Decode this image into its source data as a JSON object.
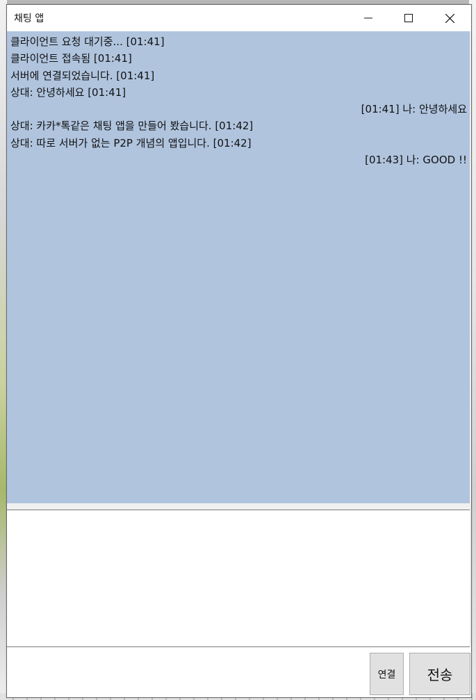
{
  "window": {
    "title": "채팅 앱",
    "controls": {
      "minimize_icon": "minimize-icon",
      "maximize_icon": "maximize-icon",
      "close_icon": "close-icon"
    }
  },
  "chat": {
    "background": "#b0c4de",
    "messages": [
      {
        "text": "클라이언트 요청 대기중...  [01:41]",
        "align": "left"
      },
      {
        "text": "클라이언트 접속됨  [01:41]",
        "align": "left"
      },
      {
        "text": "서버에 연결되었습니다.  [01:41]",
        "align": "left"
      },
      {
        "text": "상대: 안녕하세요  [01:41]",
        "align": "left"
      },
      {
        "text": "[01:41]  나: 안녕하세요",
        "align": "right"
      },
      {
        "text": "상대: 카카*톡같은 채팅 앱을 만들어 봤습니다.  [01:42]",
        "align": "left"
      },
      {
        "text": "상대: 따로 서버가 없는 P2P 개념의 앱입니다.  [01:42]",
        "align": "left"
      },
      {
        "text": "[01:43]  나: GOOD !!",
        "align": "right"
      }
    ]
  },
  "input": {
    "value": "",
    "placeholder": ""
  },
  "buttons": {
    "connect_label": "연결",
    "send_label": "전송"
  }
}
